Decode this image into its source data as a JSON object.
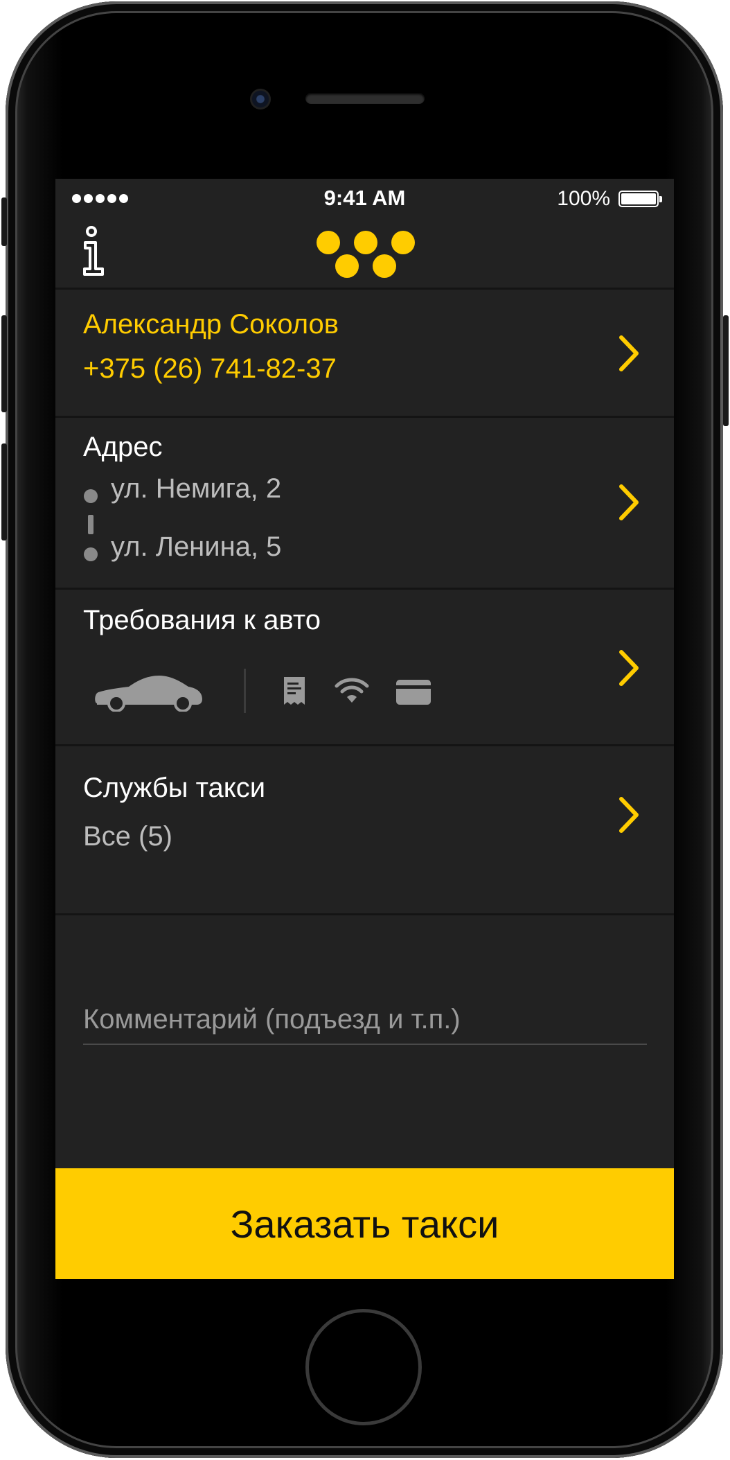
{
  "status_bar": {
    "time": "9:41 AM",
    "battery": "100%"
  },
  "profile": {
    "name": "Александр Соколов",
    "phone": "+375 (26) 741-82-37"
  },
  "address": {
    "title": "Адрес",
    "from": "ул. Немига, 2",
    "to": "ул. Ленина, 5"
  },
  "requirements": {
    "title": "Требования к авто",
    "icons": [
      "car-icon",
      "receipt-icon",
      "wifi-icon",
      "card-icon"
    ]
  },
  "services": {
    "title": "Службы такси",
    "value": "Все (5)"
  },
  "comment": {
    "placeholder": "Комментарий (подъезд и т.п.)",
    "value": ""
  },
  "order_button": {
    "label": "Заказать такси"
  },
  "colors": {
    "accent": "#ffcc00",
    "background": "#222222",
    "secondary_text": "#bdbdbd",
    "divider": "#141414"
  }
}
